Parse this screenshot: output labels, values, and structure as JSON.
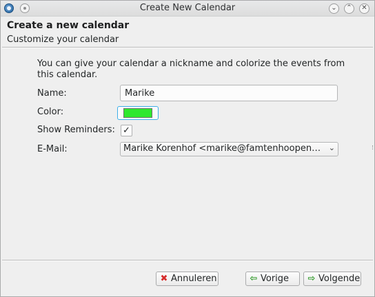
{
  "window": {
    "title": "Create New Calendar",
    "icons": {
      "app": "thunderbird-icon",
      "pin": "pin-icon",
      "minimize": "chevron-down-icon",
      "maximize": "chevron-up-icon",
      "close": "close-icon"
    },
    "glyphs": {
      "minimize": "⌄",
      "maximize": "⌃",
      "close": "✕"
    }
  },
  "header": {
    "title": "Create a new calendar",
    "subtitle": "Customize your calendar"
  },
  "form": {
    "description": "You can give your calendar a nickname and colorize the events from this calendar.",
    "name_label": "Name:",
    "name_value": "Marike",
    "color_label": "Color:",
    "color_value": "#2ee82e",
    "reminders_label": "Show Reminders:",
    "reminders_checked": true,
    "reminders_glyph": "✓",
    "email_label": "E-Mail:",
    "email_value": "Marike Korenhof <marike@famtenhoopen.…",
    "email_chevron": "⌄"
  },
  "buttons": {
    "cancel_label": "Annuleren",
    "cancel_icon": "✖",
    "back_label": "Vorige",
    "back_icon": "⇦",
    "next_label": "Volgende",
    "next_icon": "⇨"
  }
}
